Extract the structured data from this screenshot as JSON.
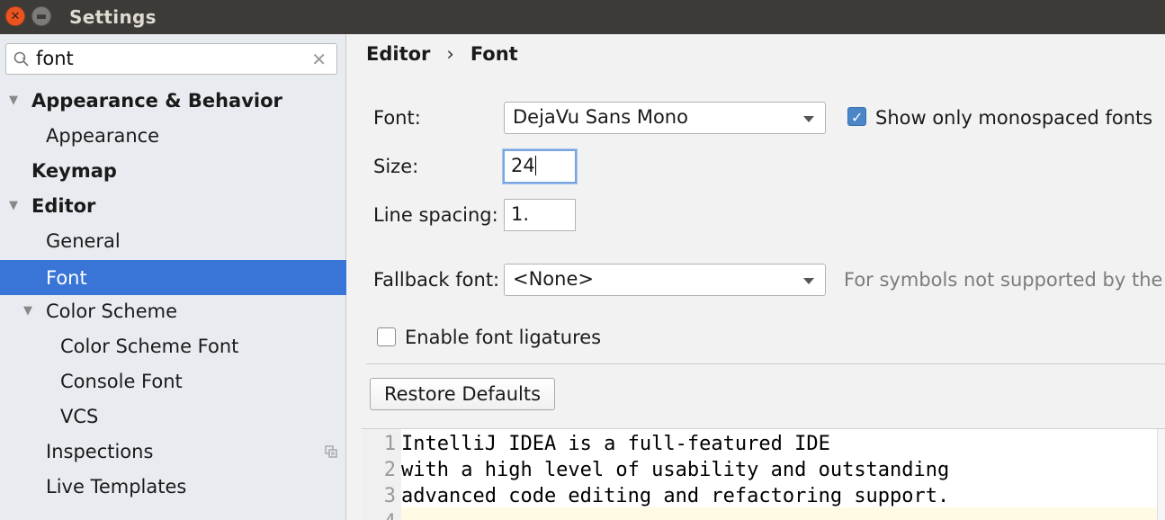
{
  "window": {
    "title": "Settings"
  },
  "sidebar": {
    "search": {
      "value": "font"
    },
    "items": [
      {
        "label": "Appearance & Behavior"
      },
      {
        "label": "Appearance"
      },
      {
        "label": "Keymap"
      },
      {
        "label": "Editor"
      },
      {
        "label": "General"
      },
      {
        "label": "Font"
      },
      {
        "label": "Color Scheme"
      },
      {
        "label": "Color Scheme Font"
      },
      {
        "label": "Console Font"
      },
      {
        "label": "VCS"
      },
      {
        "label": "Inspections"
      },
      {
        "label": "Live Templates"
      }
    ],
    "selected_item": "Font"
  },
  "breadcrumb": {
    "parent": "Editor",
    "separator": "›",
    "current": "Font"
  },
  "form": {
    "font_label": "Font:",
    "font_value": "DejaVu Sans Mono",
    "monospaced_label": "Show only monospaced fonts",
    "monospaced_checked": true,
    "size_label": "Size:",
    "size_value": "24",
    "line_spacing_label": "Line spacing:",
    "line_spacing_value": "1.",
    "fallback_label": "Fallback font:",
    "fallback_value": "<None>",
    "fallback_hint": "For symbols not supported by the m",
    "ligatures_label": "Enable font ligatures",
    "ligatures_checked": false,
    "restore_button": "Restore Defaults"
  },
  "preview": {
    "lines": [
      {
        "num": "1",
        "text": "IntelliJ IDEA is a full-featured IDE"
      },
      {
        "num": "2",
        "text": "with a high level of usability and outstanding"
      },
      {
        "num": "3",
        "text": "advanced code editing and refactoring support."
      },
      {
        "num": "4",
        "text": ""
      }
    ]
  },
  "colors": {
    "selection": "#3875d7",
    "checkbox_checked": "#4a86c8",
    "titlebar": "#3c3b37",
    "close_button": "#e95420"
  }
}
